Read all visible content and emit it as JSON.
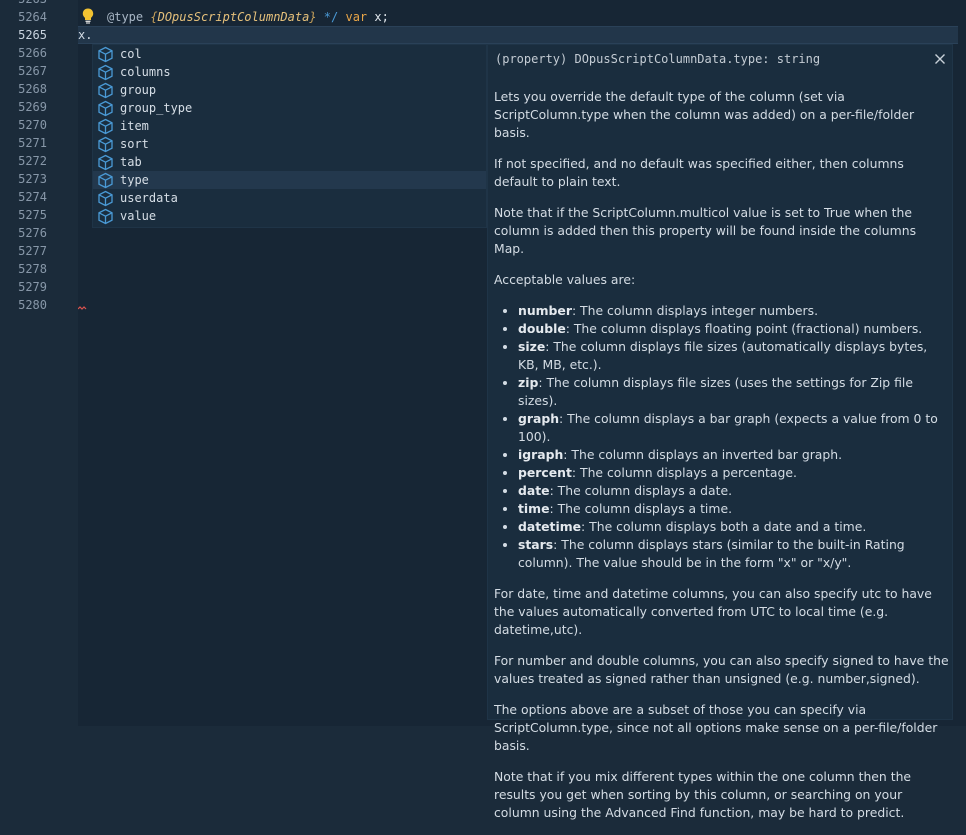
{
  "gutter": {
    "line_numbers": [
      "5264",
      "5265",
      "5266",
      "5267",
      "5268",
      "5269",
      "5270",
      "5271",
      "5272",
      "5273",
      "5274",
      "5275",
      "5276",
      "5277",
      "5278",
      "5279",
      "5280"
    ],
    "active_line": "5265"
  },
  "code": {
    "line1": {
      "at_type": "@type",
      "open_brace": "{",
      "class_name": "DOpusScriptColumnData",
      "close_brace": "}",
      "comment_end": "*/",
      "keyword": "var",
      "rest": "x;"
    },
    "line2": "x."
  },
  "suggest": {
    "items": [
      "col",
      "columns",
      "group",
      "group_type",
      "item",
      "sort",
      "tab",
      "type",
      "userdata",
      "value"
    ],
    "selected": "type",
    "icon": "property-cube-icon"
  },
  "details": {
    "signature": "(property) DOpusScriptColumnData.type: string",
    "close_icon": "close-icon",
    "p1": "Lets you override the default type of the column (set via ScriptColumn.type when the column was added) on a per-file/folder basis.",
    "p2": "If not specified, and no default was specified either, then columns default to plain text.",
    "p3": "Note that if the ScriptColumn.multicol value is set to True when the column is added then this property will be found inside the columns Map.",
    "p4": "Acceptable values are:",
    "values": [
      {
        "name": "number",
        "desc": ": The column displays integer numbers."
      },
      {
        "name": "double",
        "desc": ": The column displays floating point (fractional) numbers."
      },
      {
        "name": "size",
        "desc": ": The column displays file sizes (automatically displays bytes, KB, MB, etc.)."
      },
      {
        "name": "zip",
        "desc": ": The column displays file sizes (uses the settings for Zip file sizes)."
      },
      {
        "name": "graph",
        "desc": ": The column displays a bar graph (expects a value from 0 to 100)."
      },
      {
        "name": "igraph",
        "desc": ": The column displays an inverted bar graph."
      },
      {
        "name": "percent",
        "desc": ": The column displays a percentage."
      },
      {
        "name": "date",
        "desc": ": The column displays a date."
      },
      {
        "name": "time",
        "desc": ": The column displays a time."
      },
      {
        "name": "datetime",
        "desc": ": The column displays both a date and a time."
      },
      {
        "name": "stars",
        "desc": ": The column displays stars (similar to the built-in Rating column). The value should be in the form \"x\" or \"x/y\"."
      }
    ],
    "p5": "For date, time and datetime columns, you can also specify utc to have the values automatically converted from UTC to local time (e.g. datetime,utc).",
    "p6": "For number and double columns, you can also specify signed to have the values treated as signed rather than unsigned (e.g. number,signed).",
    "p7": "The options above are a subset of those you can specify via ScriptColumn.type, since not all options make sense on a per-file/folder basis.",
    "p8": "Note that if you mix different types within the one column then the results you get when sorting by this column, or searching on your column using the Advanced Find function, may be hard to predict."
  },
  "colors": {
    "background": "#172635",
    "gutter": "#1b2b3a",
    "widget": "#1a2d3e",
    "selection": "#23384d",
    "accent_blue": "#4a9ad6",
    "keyword_orange": "#e8a548",
    "class_yellow": "#e5c07b"
  }
}
